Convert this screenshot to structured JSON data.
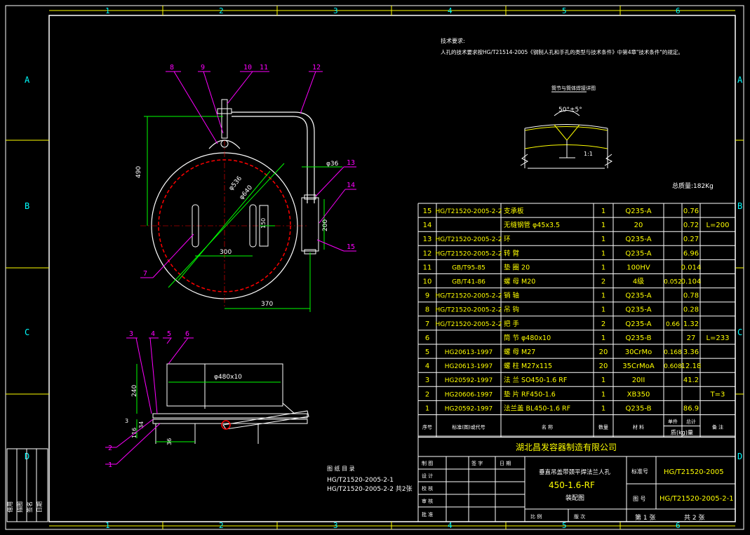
{
  "frame": {
    "col_numbers": [
      "1",
      "2",
      "3",
      "4",
      "5",
      "6"
    ],
    "row_letters": [
      "A",
      "B",
      "C",
      "D"
    ]
  },
  "tech_requirements": {
    "title": "技术要求:",
    "line1": "人孔的技术要求按HG/T21514-2005《钢制人孔和手孔的类型与技术条件》中第4章\"技术条件\"的规定。"
  },
  "weld_detail": {
    "title": "筒节与筒体焊接详图",
    "angle": "50°±5°",
    "ratio": "1:1"
  },
  "total_mass": "总质量:182Kg",
  "top_view_labels": {
    "balloons": [
      "8",
      "9",
      "10",
      "11",
      "12",
      "13",
      "14",
      "15",
      "7"
    ],
    "dim_490": "490",
    "dim_phi536": "φ536",
    "dim_phi640": "φ640",
    "dim_phi36": "φ36",
    "dim_150": "150",
    "dim_200": "200",
    "dim_300": "300",
    "dim_370": "370"
  },
  "side_view_labels": {
    "balloons": [
      "3",
      "4",
      "5",
      "6",
      "2",
      "1"
    ],
    "dim_phi480": "φ480x10",
    "dim_240": "240",
    "dim_3": "3",
    "dim_34": "34",
    "dim_116": "116",
    "dim_36": "36"
  },
  "drawing_list": {
    "title": "图 纸 目 录",
    "items": [
      "HG/T21520-2005-2-1",
      "HG/T21520-2005-2-2 共2张"
    ]
  },
  "bom": {
    "rows": [
      {
        "no": "15",
        "std": "HG/T21520-2005-2-2",
        "name": "支承板",
        "qty": "1",
        "mat": "Q235-A",
        "unit": "",
        "total": "0.76",
        "note": ""
      },
      {
        "no": "14",
        "std": "",
        "name": "无缝钢管 φ45x3.5",
        "qty": "1",
        "mat": "20",
        "unit": "",
        "total": "0.72",
        "note": "L=200"
      },
      {
        "no": "13",
        "std": "HG/T21520-2005-2-2",
        "name": "环",
        "qty": "1",
        "mat": "Q235-A",
        "unit": "",
        "total": "0.27",
        "note": ""
      },
      {
        "no": "12",
        "std": "HG/T21520-2005-2-2",
        "name": "转 臂",
        "qty": "1",
        "mat": "Q235-A",
        "unit": "",
        "total": "6.96",
        "note": ""
      },
      {
        "no": "11",
        "std": "GB/T95-85",
        "name": "垫 圈 20",
        "qty": "1",
        "mat": "100HV",
        "unit": "",
        "total": "0.014",
        "note": ""
      },
      {
        "no": "10",
        "std": "GB/T41-86",
        "name": "螺 母 M20",
        "qty": "2",
        "mat": "4级",
        "unit": "0.052",
        "total": "0.104",
        "note": ""
      },
      {
        "no": "9",
        "std": "HG/T21520-2005-2-2",
        "name": "销 轴",
        "qty": "1",
        "mat": "Q235-A",
        "unit": "",
        "total": "0.78",
        "note": ""
      },
      {
        "no": "8",
        "std": "HG/T21520-2005-2-2",
        "name": "吊 钩",
        "qty": "1",
        "mat": "Q235-A",
        "unit": "",
        "total": "0.28",
        "note": ""
      },
      {
        "no": "7",
        "std": "HG/T21520-2005-2-2",
        "name": "把 手",
        "qty": "2",
        "mat": "Q235-A",
        "unit": "0.66",
        "total": "1.32",
        "note": ""
      },
      {
        "no": "6",
        "std": "",
        "name": "筒 节 φ480x10",
        "qty": "1",
        "mat": "Q235-B",
        "unit": "",
        "total": "27",
        "note": "L=233"
      },
      {
        "no": "5",
        "std": "HG20613-1997",
        "name": "螺 母 M27",
        "qty": "20",
        "mat": "30CrMo",
        "unit": "0.168",
        "total": "3.36",
        "note": ""
      },
      {
        "no": "4",
        "std": "HG20613-1997",
        "name": "螺 柱 M27x115",
        "qty": "20",
        "mat": "35CrMoA",
        "unit": "0.608",
        "total": "12.18",
        "note": ""
      },
      {
        "no": "3",
        "std": "HG20592-1997",
        "name": "法 兰 SO450-1.6 RF",
        "qty": "1",
        "mat": "20II",
        "unit": "",
        "total": "41.2",
        "note": ""
      },
      {
        "no": "2",
        "std": "HG20606-1997",
        "name": "垫 片 RF450-1.6",
        "qty": "1",
        "mat": "XB350",
        "unit": "",
        "total": "",
        "note": "T=3"
      },
      {
        "no": "1",
        "std": "HG20592-1997",
        "name": "法兰盖 BL450-1.6 RF",
        "qty": "1",
        "mat": "Q235-B",
        "unit": "",
        "total": "86.9",
        "note": ""
      }
    ],
    "header": {
      "no": "序号",
      "std": "标准(图)或代号",
      "name": "名 称",
      "qty": "数量",
      "mat": "材 料",
      "unit": "单件",
      "total": "总计",
      "mass": "质(kg)量",
      "note": "备 注"
    }
  },
  "title_block": {
    "company": "湖北昌发容器制造有限公司",
    "product": "垂直吊盖带颈平焊法兰人孔",
    "spec": "450-1.6-RF",
    "drawing_type": "装配图",
    "std_label": "标准号",
    "std_value": "HG/T21520-2005",
    "fig_label": "图 号",
    "fig_value": "HG/T21520-2005-2-1",
    "sign_rows": [
      "制 图",
      "设 计",
      "校 核",
      "审 核",
      "批 准"
    ],
    "sign_headers": [
      "签 字",
      "日 期"
    ],
    "scale_label": "比 例",
    "sheet_label": "版 次",
    "page_text": "第 1 张",
    "total_text": "共 2 张"
  },
  "left_strip": [
    "借用",
    "描图",
    "签名",
    "日期"
  ],
  "colors": {
    "frame": "#ffffff",
    "yellow": "#ffff00",
    "green": "#00ff00",
    "red": "#ff0000",
    "magenta": "#ff00ff",
    "cyan": "#00ffff"
  }
}
